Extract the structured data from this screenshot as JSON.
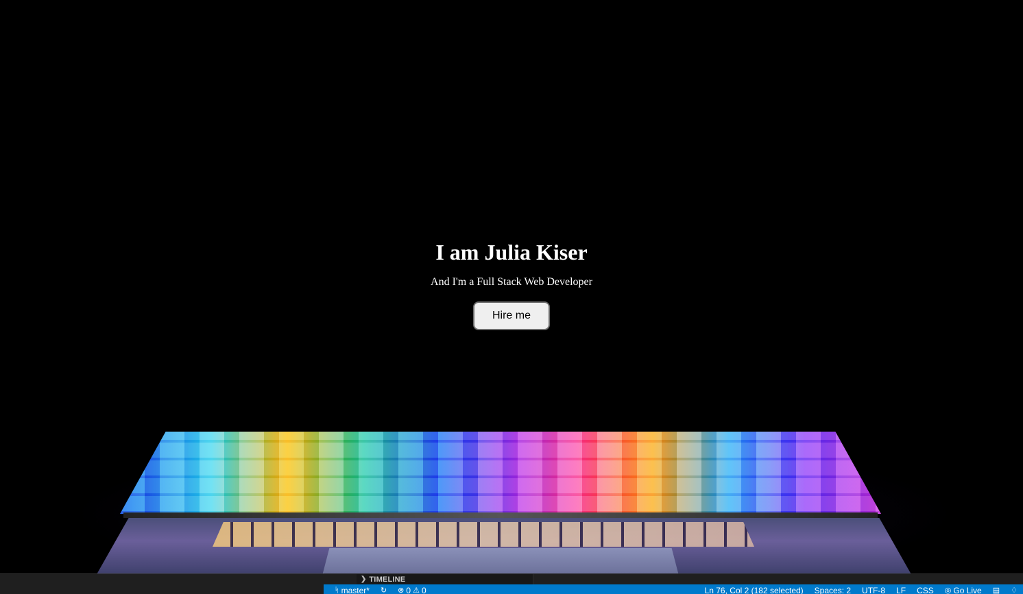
{
  "hero": {
    "title": "I am Julia Kiser",
    "subtitle": "And I'm a Full Stack Web Developer",
    "cta_label": "Hire me"
  },
  "panel": {
    "timeline_label": "TIMELINE"
  },
  "status_bar": {
    "branch": "master*",
    "errors": "0",
    "warnings": "0",
    "cursor": "Ln 76, Col 2 (182 selected)",
    "spaces": "Spaces: 2",
    "encoding": "UTF-8",
    "eol": "LF",
    "language": "CSS",
    "go_live": "Go Live",
    "color": "#007acc"
  }
}
